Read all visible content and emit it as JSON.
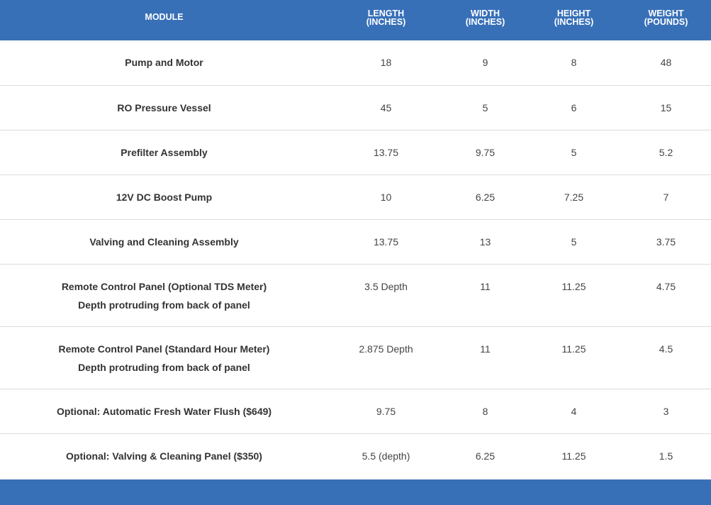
{
  "header": {
    "module": "MODULE",
    "length": [
      "LENGTH",
      "(INCHES)"
    ],
    "width": [
      "WIDTH",
      "(INCHES)"
    ],
    "height": [
      "HEIGHT",
      "(INCHES)"
    ],
    "weight": [
      "WEIGHT",
      "(POUNDS)"
    ]
  },
  "rows": [
    {
      "module": [
        "Pump and Motor"
      ],
      "length": "18",
      "width": "9",
      "height": "8",
      "weight": "48"
    },
    {
      "module": [
        "RO Pressure Vessel"
      ],
      "length": "45",
      "width": "5",
      "height": "6",
      "weight": "15"
    },
    {
      "module": [
        "Prefilter Assembly"
      ],
      "length": "13.75",
      "width": "9.75",
      "height": "5",
      "weight": "5.2"
    },
    {
      "module": [
        "12V DC Boost Pump"
      ],
      "length": "10",
      "width": "6.25",
      "height": "7.25",
      "weight": "7"
    },
    {
      "module": [
        "Valving and Cleaning Assembly"
      ],
      "length": "13.75",
      "width": "13",
      "height": "5",
      "weight": "3.75"
    },
    {
      "module": [
        "Remote Control Panel (Optional TDS Meter)",
        "Depth protruding from back of panel"
      ],
      "length": "3.5 Depth",
      "width": "11",
      "height": "11.25",
      "weight": "4.75"
    },
    {
      "module": [
        "Remote Control Panel (Standard Hour Meter)",
        "Depth protruding from back of panel"
      ],
      "length": "2.875 Depth",
      "width": "11",
      "height": "11.25",
      "weight": "4.5"
    },
    {
      "module": [
        "Optional: Automatic Fresh Water Flush ($649)"
      ],
      "length": "9.75",
      "width": "8",
      "height": "4",
      "weight": "3"
    },
    {
      "module": [
        "Optional: Valving & Cleaning Panel ($350)"
      ],
      "length": "5.5 (depth)",
      "width": "6.25",
      "height": "11.25",
      "weight": "1.5"
    }
  ],
  "colors": {
    "header_bg": "#3870b8",
    "footer_bg": "#3870b8",
    "row_border": "#dcdcdc"
  }
}
